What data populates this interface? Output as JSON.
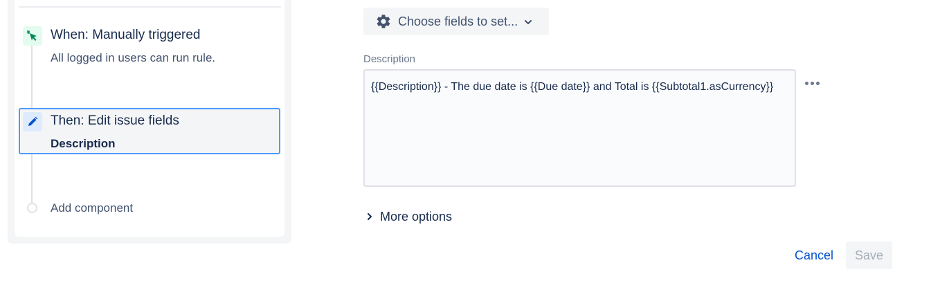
{
  "rule": {
    "trigger": {
      "icon": "cursor-click-icon",
      "title": "When: Manually triggered",
      "subtitle": "All logged in users can run rule."
    },
    "action": {
      "icon": "pencil-icon",
      "title": "Then: Edit issue fields",
      "subtitle": "Description"
    },
    "add_component_label": "Add component"
  },
  "editor": {
    "choose_fields_label": "Choose fields to set...",
    "description_label": "Description",
    "description_value": "{{Description}} - The due date is {{Due date}} and Total is {{Subtotal1.asCurrency}}",
    "more_options_label": "More options",
    "cancel_label": "Cancel",
    "save_label": "Save"
  },
  "colors": {
    "trigger_icon_bg": "#e3fcef",
    "trigger_icon_fg": "#00875a",
    "action_icon_bg": "#deebff",
    "action_icon_fg": "#0052cc",
    "selected_border": "#4c9aff",
    "link": "#0052cc"
  }
}
